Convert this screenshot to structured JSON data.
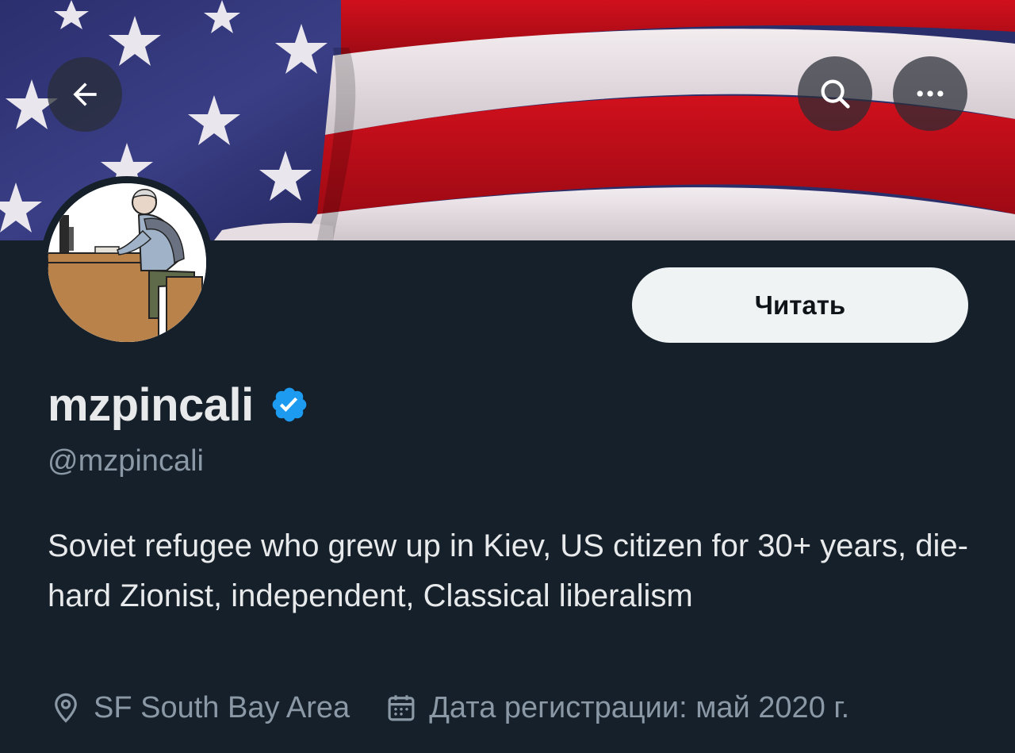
{
  "banner": {
    "description_icon": "us-flag-banner"
  },
  "nav": {
    "back_icon": "arrow-left-icon",
    "search_icon": "search-icon",
    "more_icon": "more-dots-icon"
  },
  "profile": {
    "display_name": "mzpincali",
    "handle": "@mzpincali",
    "verified": true,
    "bio": "Soviet refugee who grew up in Kiev, US citizen for 30+ years, die-hard Zionist, independent, Classical liberalism",
    "location": "SF South Bay Area",
    "joined": "Дата регистрации: май 2020 г."
  },
  "actions": {
    "follow_label": "Читать"
  },
  "colors": {
    "background": "#15202b",
    "primary_text": "#e7e9ea",
    "secondary_text": "#8b98a5",
    "verified_blue": "#1d9bf0",
    "button_bg": "#eff3f4"
  }
}
